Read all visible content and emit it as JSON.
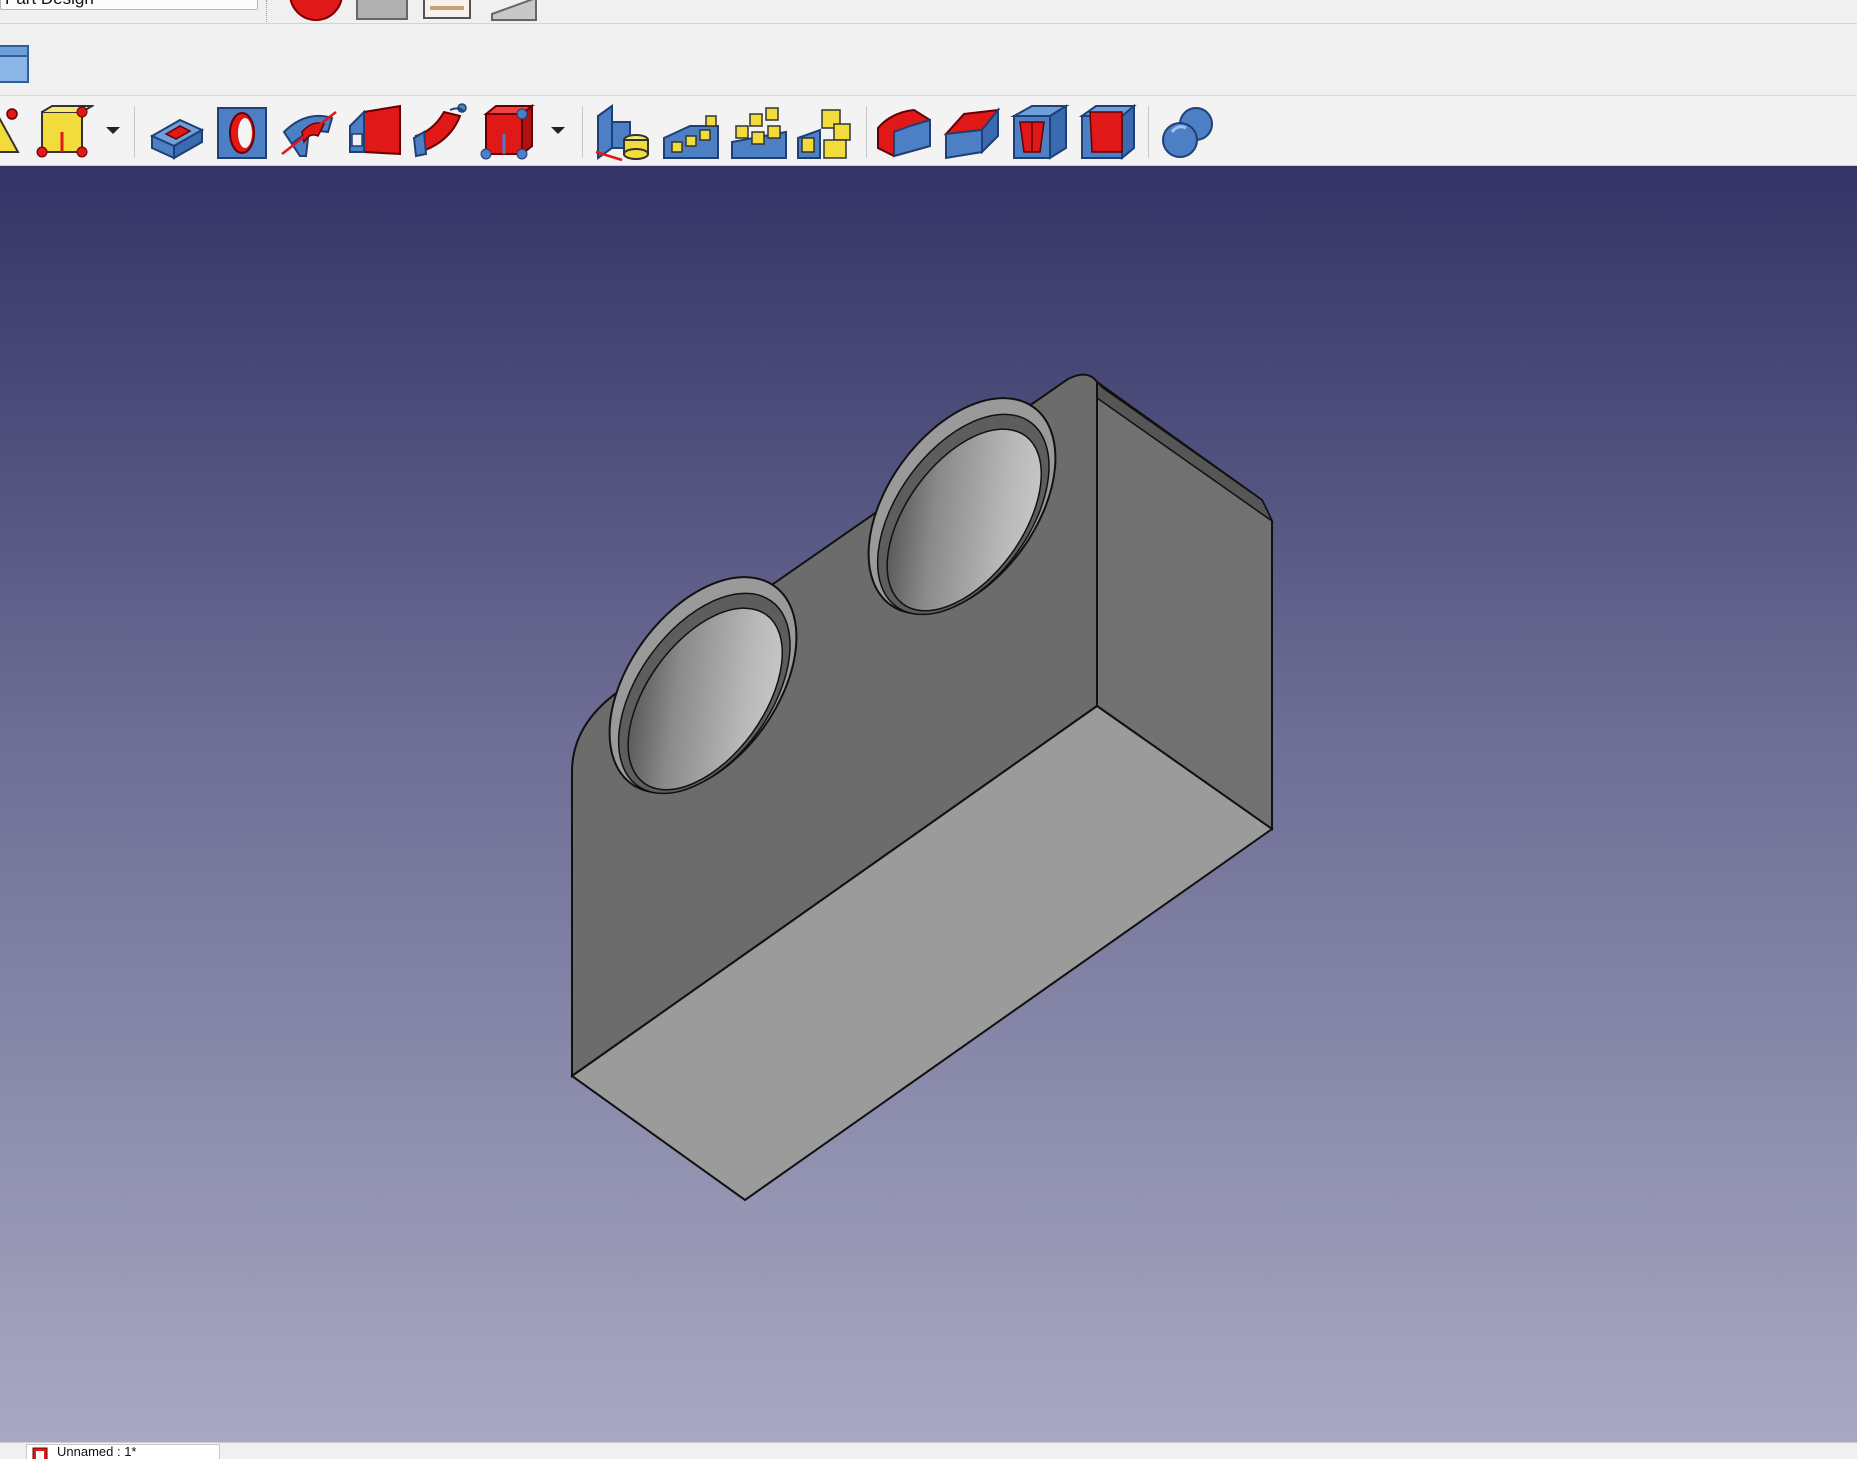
{
  "workbench_selector": {
    "value": "Part Design"
  },
  "document_tab": {
    "label": "Unnamed : 1*"
  },
  "icons": {
    "top_bar": [
      "macro-record-icon",
      "macro-stop-icon",
      "macro-editor-icon",
      "macro-execute-icon"
    ],
    "toolbar2": [
      "open-folder-icon"
    ],
    "toolbar3": [
      "create-datum-point-icon",
      "create-shape-binder-icon",
      "pocket-icon",
      "hole-icon",
      "groove-icon",
      "subtractive-loft-icon",
      "subtractive-pipe-icon",
      "subtractive-primitive-icon",
      "mirrored-icon",
      "linear-pattern-icon",
      "polar-pattern-icon",
      "multitransform-icon",
      "fillet-icon",
      "chamfer-icon",
      "draft-icon",
      "thickness-icon",
      "boolean-icon"
    ]
  },
  "colors": {
    "viewport_top": "#333366",
    "viewport_bottom": "#a8a8c2",
    "model_face": "#707070",
    "icon_blue": "#4d7fc4",
    "icon_red": "#e01818",
    "icon_yellow": "#f2dc3c"
  }
}
